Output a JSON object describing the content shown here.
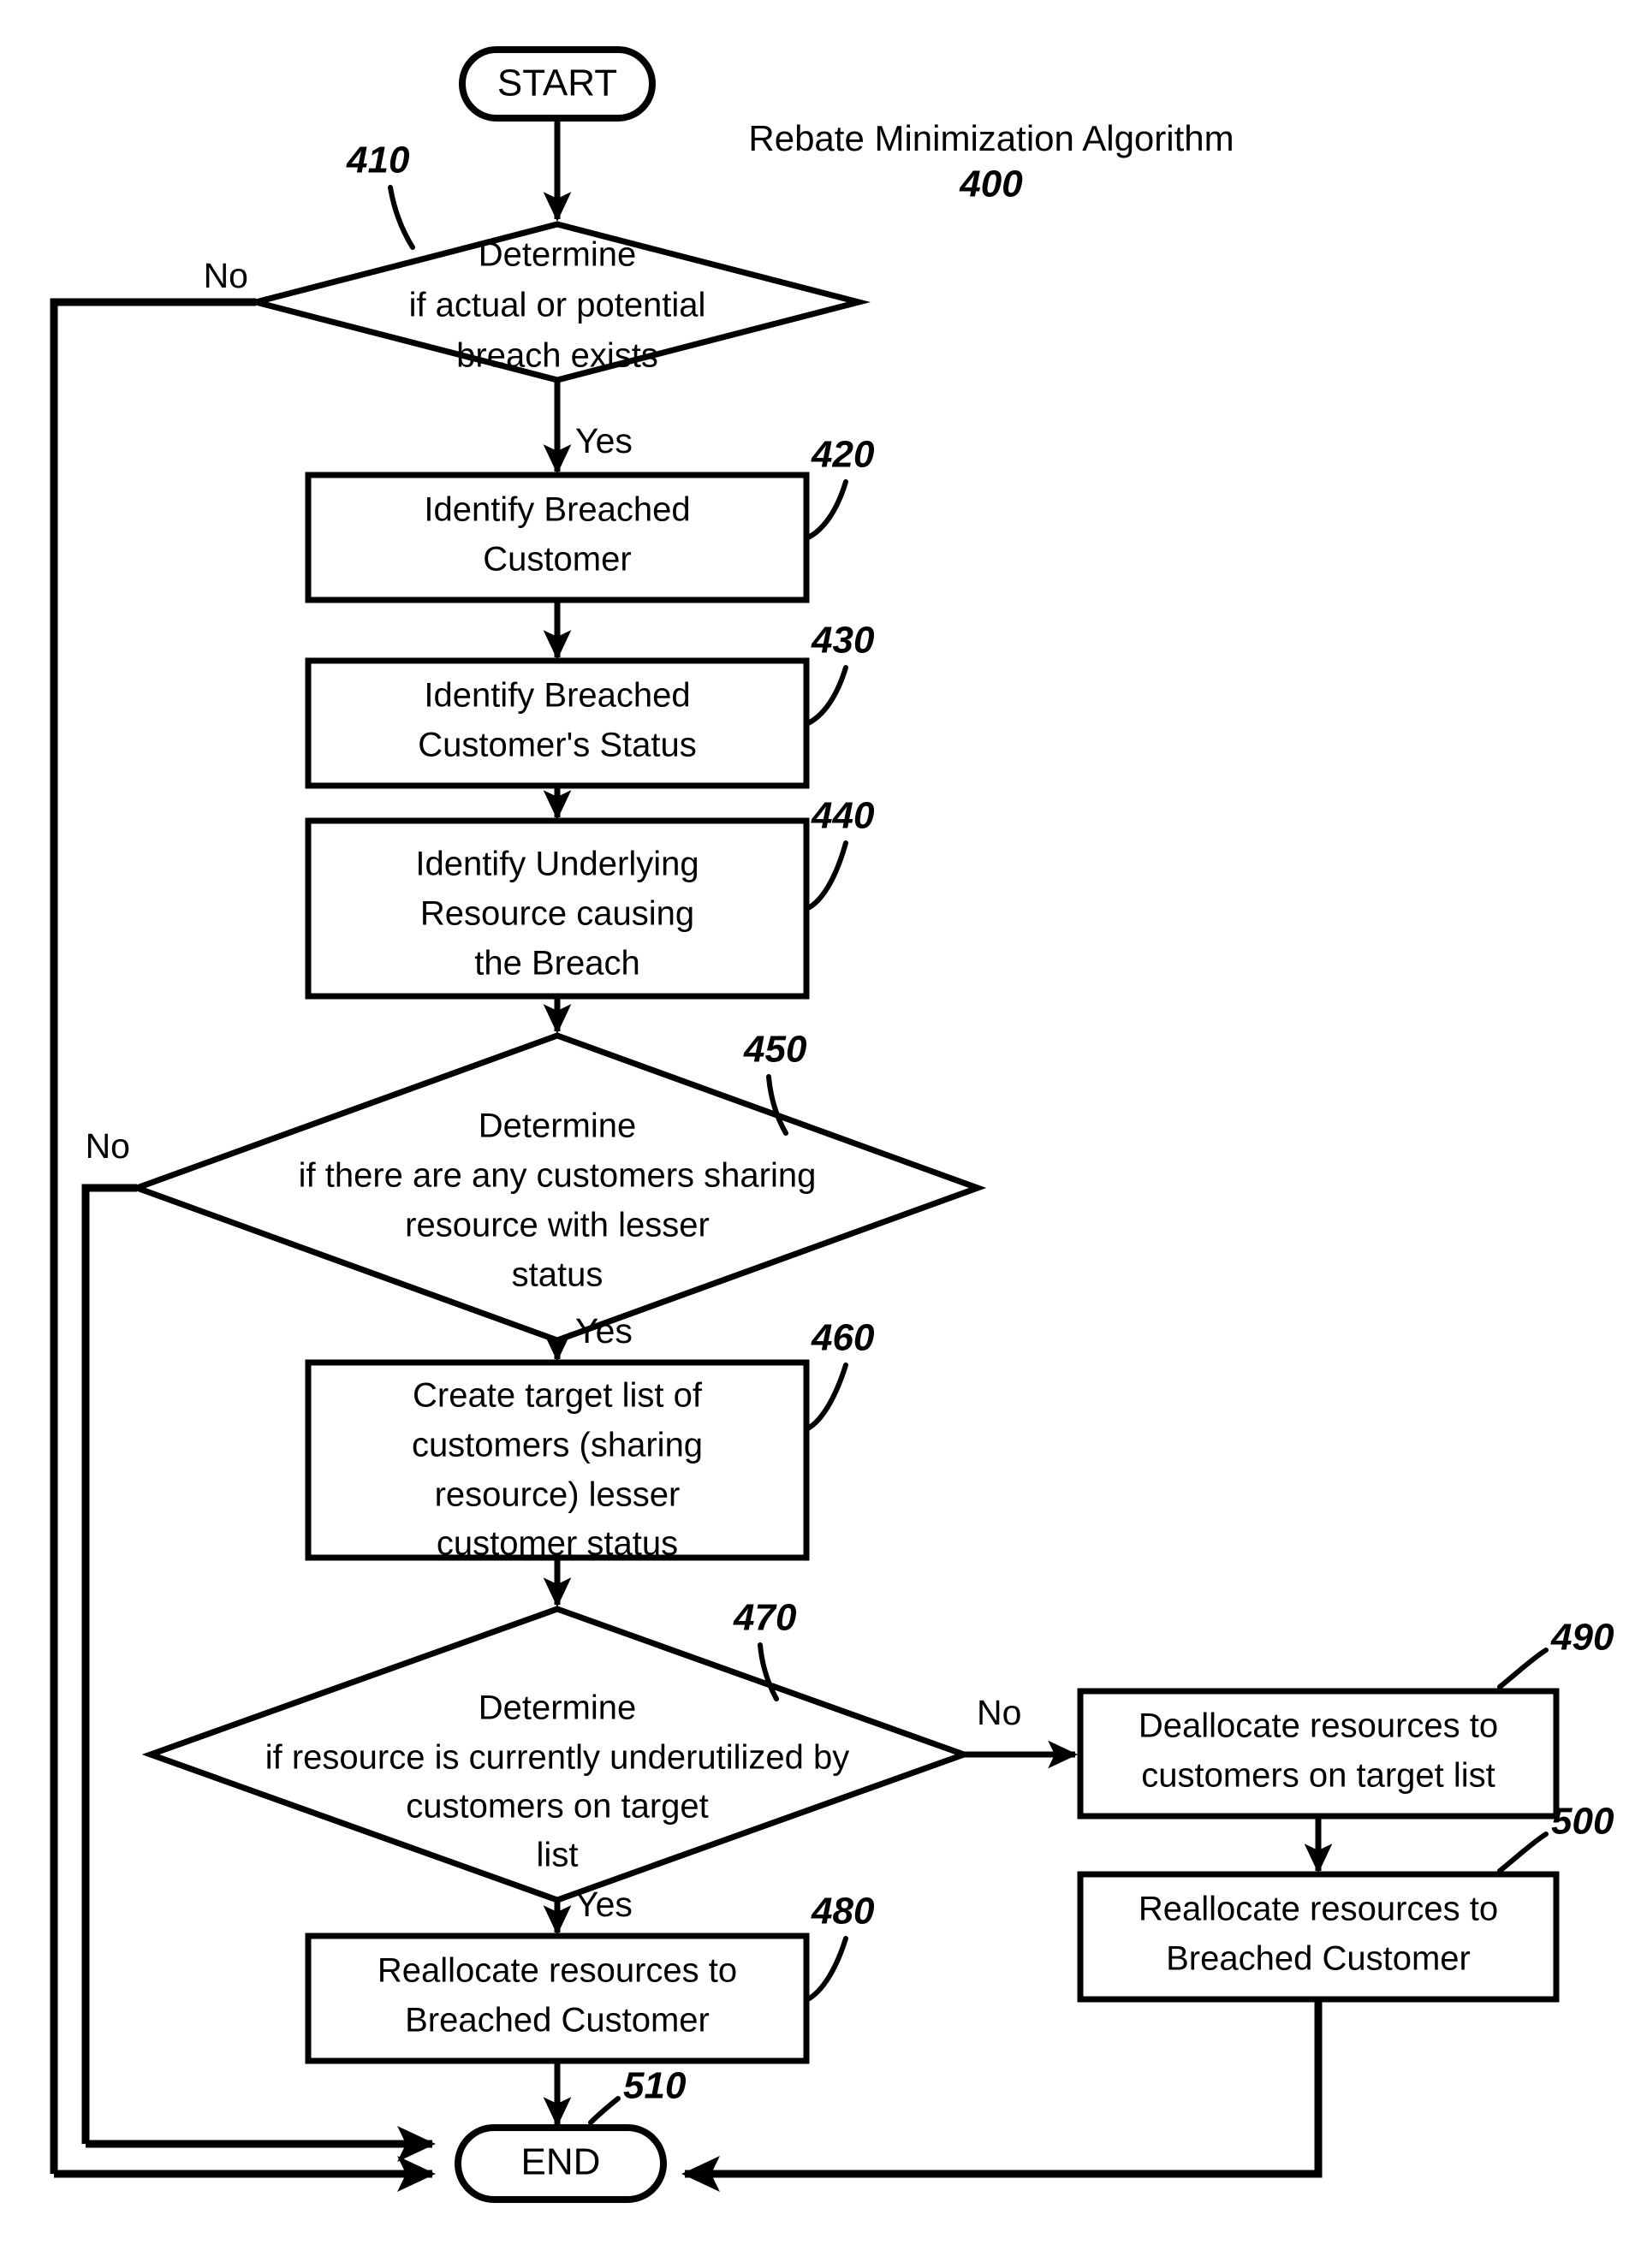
{
  "figure": {
    "title": "Rebate Minimization Algorithm",
    "figure_number": "400"
  },
  "nodes": {
    "start": {
      "label": "START",
      "type": "terminator"
    },
    "end": {
      "label": "END",
      "type": "terminator",
      "ref": "510"
    },
    "d410": {
      "ref": "410",
      "type": "decision",
      "line1": "Determine",
      "line2": "if actual or potential",
      "line3": "breach exists"
    },
    "p420": {
      "ref": "420",
      "type": "process",
      "line1": "Identify Breached",
      "line2": "Customer"
    },
    "p430": {
      "ref": "430",
      "type": "process",
      "line1": "Identify Breached",
      "line2": "Customer's Status"
    },
    "p440": {
      "ref": "440",
      "type": "process",
      "line1": "Identify Underlying",
      "line2": "Resource causing",
      "line3": "the Breach"
    },
    "d450": {
      "ref": "450",
      "type": "decision",
      "line1": "Determine",
      "line2": "if there are any customers sharing",
      "line3": "resource with lesser",
      "line4": "status"
    },
    "p460": {
      "ref": "460",
      "type": "process",
      "line1": "Create target list of",
      "line2": "customers (sharing",
      "line3": "resource) lesser",
      "line4": "customer status"
    },
    "d470": {
      "ref": "470",
      "type": "decision",
      "line1": "Determine",
      "line2": "if resource is currently underutilized by",
      "line3": "customers on target",
      "line4": "list"
    },
    "p480": {
      "ref": "480",
      "type": "process",
      "line1": "Reallocate resources to",
      "line2": "Breached Customer"
    },
    "p490": {
      "ref": "490",
      "type": "process",
      "line1": "Deallocate resources to",
      "line2": "customers on target list"
    },
    "p500": {
      "ref": "500",
      "type": "process",
      "line1": "Reallocate resources to",
      "line2": "Breached Customer"
    }
  },
  "branches": {
    "d410_no": "No",
    "d410_yes": "Yes",
    "d450_no": "No",
    "d450_yes": "Yes",
    "d470_no": "No",
    "d470_yes": "Yes"
  },
  "colors": {
    "ink": "#000000",
    "paper": "#ffffff"
  }
}
